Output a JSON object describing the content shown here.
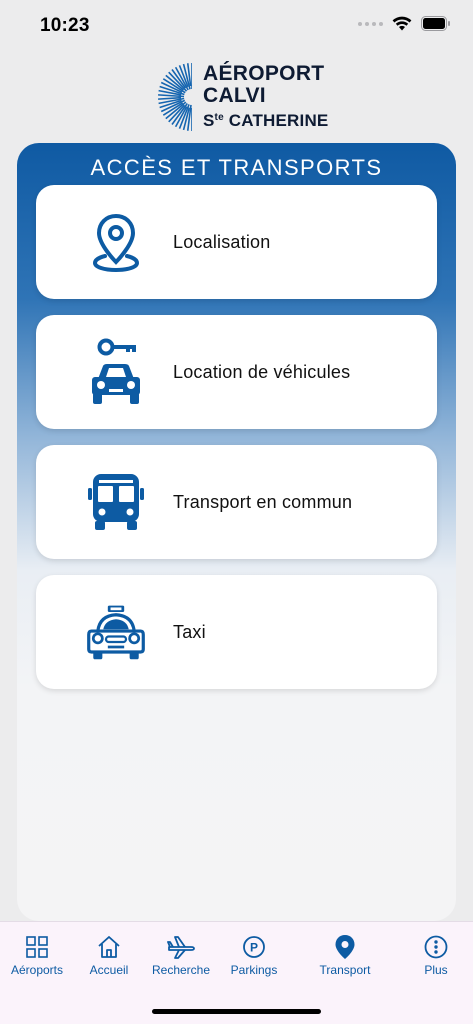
{
  "status_bar": {
    "time": "10:23"
  },
  "logo": {
    "line1": "AÉROPORT",
    "line2": "CALVI",
    "line3_prefix": "S",
    "line3_sup": "te",
    "line3_rest": " CATHERINE"
  },
  "panel": {
    "title": "ACCÈS ET TRANSPORTS",
    "items": [
      {
        "label": "Localisation",
        "icon": "location-pin-icon"
      },
      {
        "label": "Location de véhicules",
        "icon": "car-rental-icon"
      },
      {
        "label": "Transport en commun",
        "icon": "bus-icon"
      },
      {
        "label": "Taxi",
        "icon": "taxi-icon"
      }
    ]
  },
  "tabbar": {
    "tabs": [
      {
        "label": "Aéroports",
        "icon": "grid-icon"
      },
      {
        "label": "Accueil",
        "icon": "home-icon"
      },
      {
        "label": "Recherche",
        "icon": "plane-icon"
      },
      {
        "label": "Parkings",
        "icon": "parking-icon"
      },
      {
        "label": "Transport",
        "icon": "location-pin-icon",
        "active": true
      },
      {
        "label": "Plus",
        "icon": "more-icon"
      }
    ]
  },
  "colors": {
    "accent": "#0d5ba3",
    "panel_top": "#0f5aa3",
    "tabbar_bg": "#fbf3fb"
  }
}
